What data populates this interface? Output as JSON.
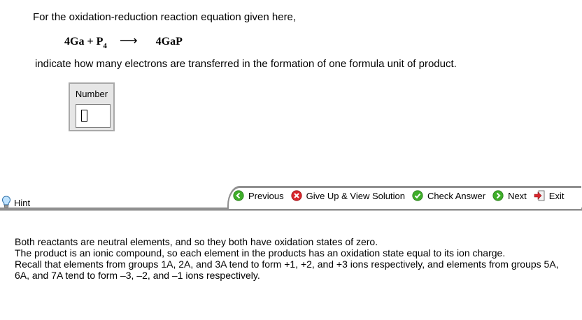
{
  "question": {
    "intro": "For the oxidation-reduction reaction equation given here,",
    "equation": {
      "reactant1": "4Ga",
      "plus": "+",
      "reactant2": "P",
      "reactant2_subscript": "4",
      "arrow": "⟶",
      "product": "4GaP"
    },
    "instruction": "indicate how many electrons are transferred in the formation of one formula unit of product."
  },
  "answer": {
    "label": "Number",
    "value": ""
  },
  "hint": {
    "label": "Hint",
    "icon": "lightbulb-icon"
  },
  "nav": {
    "previous": "Previous",
    "give_up": "Give Up & View Solution",
    "check": "Check Answer",
    "next": "Next",
    "exit": "Exit"
  },
  "explanation": [
    "Both reactants are neutral elements, and so they both have oxidation states of zero.",
    "The product is an ionic compound, so each element in the products has an oxidation state equal to its ion charge.",
    "Recall that elements from groups 1A, 2A, and 3A tend to form +1, +2, and +3 ions respectively, and elements from groups 5A, 6A, and 7A tend to form –3, –2, and –1 ions respectively."
  ],
  "colors": {
    "toolbar_gray": "#8f8f8f",
    "answer_bg": "#e6e6e6",
    "green": "#3fae2a",
    "red": "#d9262c"
  }
}
